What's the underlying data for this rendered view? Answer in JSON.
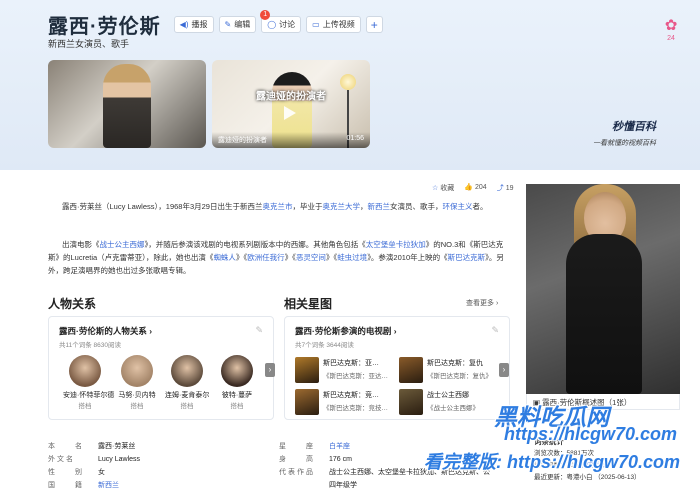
{
  "header": {
    "title": "露西·劳伦斯",
    "subtitle": "新西兰女演员、歌手",
    "buttons": {
      "audio": "播报",
      "edit": "编辑",
      "discuss": "讨论",
      "discuss_badge": "1",
      "upload": "上传视频",
      "add": "+"
    },
    "flower_count": "24"
  },
  "videos": [
    {
      "caption": "",
      "duration": ""
    },
    {
      "center_title": "露迪娅的扮演者",
      "caption": "露迪娅的扮演者",
      "duration": "01:56"
    }
  ],
  "brand": {
    "logo": "秒懂百科",
    "slogan": "一看就懂的视频百科"
  },
  "actions": {
    "collect": "收藏",
    "likes": "204",
    "shares": "19"
  },
  "intro": {
    "p1": [
      {
        "t": "露西·劳莱丝（Lucy Lawless），1968年3月29日出生于新西兰"
      },
      {
        "t": "奥克兰市",
        "link": true
      },
      {
        "t": "，毕业于"
      },
      {
        "t": "奥克兰大学",
        "link": true
      },
      {
        "t": "，"
      },
      {
        "t": "新西兰",
        "link": true
      },
      {
        "t": "女演员、歌手，"
      },
      {
        "t": "环保主义",
        "link": true
      },
      {
        "t": "者。"
      }
    ],
    "p2": [
      {
        "t": "出演电影《"
      },
      {
        "t": "战士公主西娜",
        "link": true
      },
      {
        "t": "》，并随后参演该戏剧的电视系列剧版本中的西娜。其他角色包括《"
      },
      {
        "t": "太空堡垒卡拉狄加",
        "link": true
      },
      {
        "t": "》的NO.3和《斯巴达克斯》的Lucretia（卢克雷蒂亚），除此，她也出演《"
      },
      {
        "t": "蜘蛛人",
        "link": true
      },
      {
        "t": "》《"
      },
      {
        "t": "欧洲任我行",
        "link": true
      },
      {
        "t": "》《"
      },
      {
        "t": "恶灵空间",
        "link": true
      },
      {
        "t": "》《"
      },
      {
        "t": "蛙虫过境",
        "link": true
      },
      {
        "t": "》。参演2010年上映的《"
      },
      {
        "t": "斯巴达克斯",
        "link": true
      },
      {
        "t": "》。另外，跨足演唱界的她也出过多张歌唱专辑。"
      }
    ]
  },
  "relations": {
    "section_title": "人物关系",
    "box_title": "露西·劳伦斯的人物关系",
    "meta": "共11个词条  8630阅读",
    "people": [
      {
        "name": "安迪·怀特菲尔德",
        "role": "搭档",
        "color": "#7a5a43"
      },
      {
        "name": "马努·贝内特",
        "role": "搭档",
        "color": "#a38468"
      },
      {
        "name": "连姆·麦肯泰尔",
        "role": "搭档",
        "color": "#5c4a3b"
      },
      {
        "name": "彼特·蔓萨",
        "role": "搭档",
        "color": "#3a2a22"
      }
    ]
  },
  "stars": {
    "section_title": "相关星图",
    "more": "查看更多",
    "box_title": "露西·劳伦斯参演的电视剧",
    "meta": "共7个词条  3644阅读",
    "works": [
      {
        "title": "斯巴达克斯：亚…",
        "sub": "《斯巴达克斯：亚达…",
        "color": "#b07a2a"
      },
      {
        "title": "斯巴达克斯：复仇",
        "sub": "《斯巴达克斯：复仇》",
        "color": "#8a5b2a"
      },
      {
        "title": "斯巴达克斯：竞…",
        "sub": "《斯巴达克斯：竞技…",
        "color": "#9c6a30"
      },
      {
        "title": "战士公主西娜",
        "sub": "《战士公主西娜》",
        "color": "#6b5a3a"
      }
    ]
  },
  "photo": {
    "caption": "露西·劳伦斯概述图（1张）"
  },
  "stats": {
    "title": "词条统计",
    "views": "浏览次数：5881万次",
    "edits_label": "编辑次数：70次",
    "edits_link": "历史版本",
    "updated": "最近更新：粤港小白  （2025-06-13）"
  },
  "info": {
    "rows": [
      {
        "k1": "本　　名",
        "v1": "露西·劳莱丝",
        "k2": "星　　座",
        "v2": "白羊座",
        "v2link": true
      },
      {
        "k1": "外文名",
        "v1": "Lucy Lawless",
        "k2": "身　　高",
        "v2": "176 cm"
      },
      {
        "k1": "性　　别",
        "v1": "女",
        "k2": "代表作品",
        "v2": "战士公主西娜、太空堡垒卡拉狄加、斯巴达克斯、公"
      },
      {
        "k1": "国　　籍",
        "v1": "新西兰",
        "v1link": true,
        "k2": "",
        "v2": "四年级学"
      }
    ]
  },
  "watermark": {
    "line1": "黑料吃瓜网",
    "line2": "https://hlcgw70.com",
    "line3": "看完整版: https://hlcgw70.com"
  }
}
